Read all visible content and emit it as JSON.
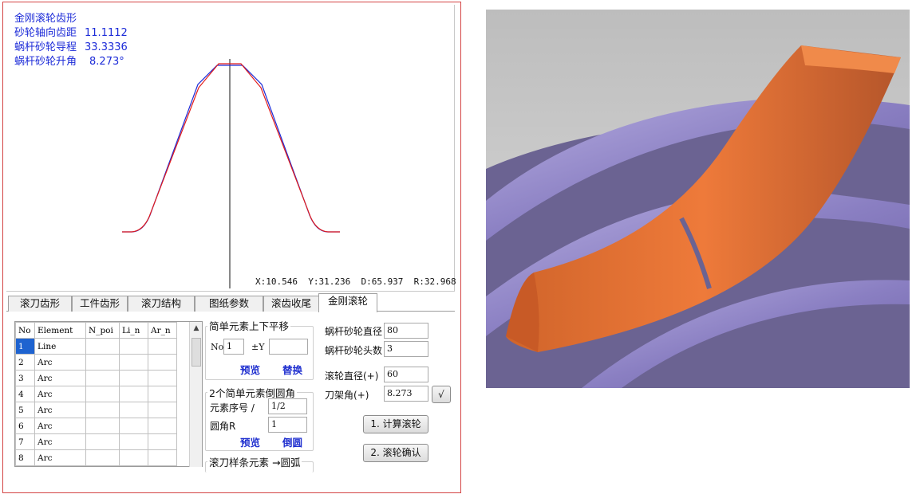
{
  "info": {
    "title": "金刚滚轮齿形",
    "rows": [
      {
        "label": "砂轮轴向齿距",
        "value": "11.1112"
      },
      {
        "label": "蜗杆砂轮导程",
        "value": "33.3336"
      },
      {
        "label": "蜗杆砂轮升角",
        "value": "8.273°"
      }
    ]
  },
  "coord_readout": "X:10.546  Y:31.236  D:65.937  R:32.968",
  "colors": {
    "profile_red": "#e21c1c",
    "profile_blue": "#1c2bd8",
    "frame_red": "#d44444",
    "selection": "#1e63d0"
  },
  "tabs": [
    {
      "label": "滚刀齿形"
    },
    {
      "label": "工件齿形"
    },
    {
      "label": "滚刀结构"
    },
    {
      "label": "图纸参数"
    },
    {
      "label": "滚齿收尾"
    },
    {
      "label": "金刚滚轮",
      "active": true
    }
  ],
  "table": {
    "columns": [
      "No",
      "Element",
      "N_poi",
      "Li_n",
      "Ar_n"
    ],
    "rows": [
      {
        "no": "1",
        "element": "Line",
        "selected": true
      },
      {
        "no": "2",
        "element": "Arc"
      },
      {
        "no": "3",
        "element": "Arc"
      },
      {
        "no": "4",
        "element": "Arc"
      },
      {
        "no": "5",
        "element": "Arc"
      },
      {
        "no": "6",
        "element": "Arc"
      },
      {
        "no": "7",
        "element": "Arc"
      },
      {
        "no": "8",
        "element": "Arc"
      }
    ]
  },
  "shift_group": {
    "title": "简单元素上下平移",
    "no_label": "No",
    "no_value": "1",
    "y_label": "±Y",
    "y_value": "",
    "preview": "预览",
    "replace": "替换"
  },
  "fillet_group": {
    "title": "2个简单元素倒圆角",
    "seq_label": "元素序号 /",
    "seq_value": "1/2",
    "radius_label": "圆角R",
    "radius_value": "1",
    "preview": "预览",
    "fillet": "倒圆"
  },
  "spline_group": {
    "title": "滚刀样条元素 →圆弧"
  },
  "params": {
    "worm_dia_label": "蜗杆砂轮直径",
    "worm_dia": "80",
    "worm_starts_label": "蜗杆砂轮头数",
    "worm_starts": "3",
    "roller_dia_label": "滚轮直径(+)",
    "roller_dia": "60",
    "frame_angle_label": "刀架角(+)",
    "frame_angle": "8.273",
    "check_btn": "√"
  },
  "buttons": {
    "calc": "1. 计算滚轮",
    "confirm": "2. 滚轮确认"
  }
}
